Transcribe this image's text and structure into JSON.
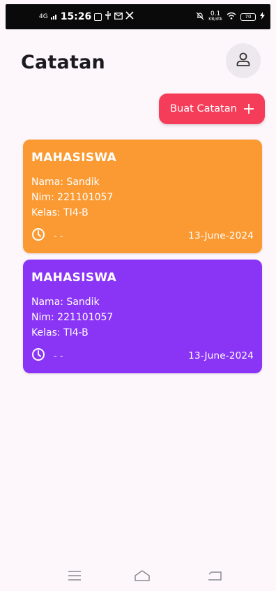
{
  "status_bar": {
    "network": "4G",
    "time": "15:26",
    "speed_value": "0.1",
    "speed_unit": "KB/dtk",
    "battery": "70"
  },
  "header": {
    "title": "Catatan"
  },
  "create_button": {
    "label": "Buat Catatan",
    "icon": "plus-icon",
    "color": "#f53d5a"
  },
  "notes": [
    {
      "title": "MAHASISWA",
      "lines": [
        "Nama: Sandik",
        "Nim: 221101057",
        "Kelas: TI4-B"
      ],
      "time": "- -",
      "date": "13-June-2024",
      "color": "#fb9a32"
    },
    {
      "title": "MAHASISWA",
      "lines": [
        "Nama: Sandik",
        "Nim: 221101057",
        "Kelas: TI4-B"
      ],
      "time": "- -",
      "date": "13-June-2024",
      "color": "#8a35f6"
    }
  ],
  "nav": {
    "icons": [
      "menu-icon",
      "home-icon",
      "back-icon"
    ]
  }
}
